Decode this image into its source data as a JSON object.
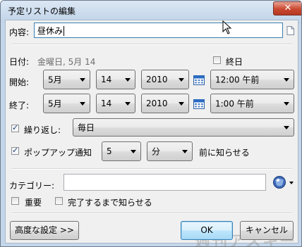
{
  "window": {
    "title": "予定リストの編集",
    "close_glyph": "✕"
  },
  "content": {
    "label": "内容:",
    "value": "昼休み",
    "note_icon": "document-icon"
  },
  "date": {
    "label": "日付:",
    "value": "金曜日, 5月 14",
    "allday_label": "終日",
    "allday_checked": false
  },
  "start": {
    "label": "開始:",
    "month": "5月",
    "day": "14",
    "year": "2010",
    "time": "12:00 午前",
    "calendar_icon": "calendar-icon"
  },
  "end": {
    "label": "終了:",
    "month": "5月",
    "day": "14",
    "year": "2010",
    "time": "1:00 午前",
    "calendar_icon": "calendar-icon"
  },
  "repeat": {
    "label": "繰り返し:",
    "checked": true,
    "value": "毎日"
  },
  "notify": {
    "label": "ポップアップ通知",
    "checked": true,
    "amount": "5",
    "unit": "分",
    "suffix": "前に知らせる"
  },
  "category": {
    "label": "カテゴリー:",
    "value": "",
    "icon": "category-sphere-icon"
  },
  "important": {
    "label": "重要",
    "checked": false
  },
  "until_done": {
    "label": "完了するまで知らせる",
    "checked": false
  },
  "buttons": {
    "advanced": "高度な設定 >>",
    "ok": "OK",
    "cancel": "キャンセル"
  },
  "watermark": "週刊アスキー",
  "colors": {
    "accent": "#3c7fb1",
    "title_bg": "#c4d6ea",
    "close": "#c9482f"
  }
}
